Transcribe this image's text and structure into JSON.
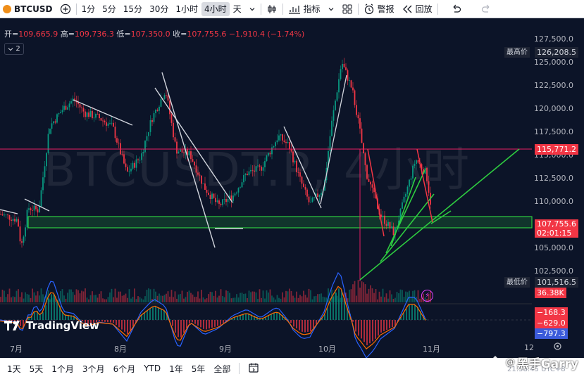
{
  "toolbar": {
    "symbol": "BTCUSD",
    "add_symbol": "+",
    "intervals": [
      "1分",
      "5分",
      "15分",
      "30分",
      "1小时",
      "4小时",
      "天"
    ],
    "selected_interval": "4小时",
    "indicators_label": "指标",
    "alert_label": "警报",
    "replay_label": "回放"
  },
  "ohlc": {
    "open_label": "开=",
    "open": "109,665.9",
    "high_label": "高=",
    "high": "109,736.3",
    "low_label": "低=",
    "low": "107,350.0",
    "close_label": "收=",
    "close": "107,755.6",
    "change": "−1,910.4 (−1.74%)"
  },
  "collapse_label": "2",
  "watermark": "BTCUSDT.P, 4小时",
  "price_axis": {
    "ticks": [
      "127,500.0",
      "125,000.0",
      "122,500.0",
      "120,000.0",
      "117,500.0",
      "115,000.0",
      "112,500.0",
      "110,000.0",
      "105,000.0",
      "102,500.0"
    ],
    "highest_label": "最高价",
    "highest": "126,208.5",
    "line_value": "115,771.2",
    "current": "107,755.6",
    "countdown": "02:01:15",
    "lowest_label": "最低价",
    "lowest": "101,516.5",
    "volume": "36.38K",
    "osc_values": [
      "−168.3",
      "−629.0",
      "−797.3"
    ]
  },
  "time_axis": [
    "7月",
    "8月",
    "9月",
    "10月",
    "11月",
    "12"
  ],
  "logo_text": "TradingView",
  "bottombar": {
    "ranges": [
      "1天",
      "5天",
      "1个月",
      "3个月",
      "6个月",
      "YTD",
      "1年",
      "5年",
      "全部"
    ]
  },
  "author": "黑手Garry",
  "clock": "21:58:45 UTC+8",
  "colors": {
    "background": "#0c1428",
    "up": "#089981",
    "down": "#f23645",
    "support_zone": "#2ecc40",
    "resistance_line": "#e91e63",
    "trend_lines": "#2ecc40",
    "drawn_lines": "#d1d4dc"
  },
  "icons": [
    "bar-style-icon",
    "indicators-icon",
    "layout-icon",
    "alert-icon",
    "replay-icon",
    "undo-icon",
    "redo-icon",
    "range-calendar-icon",
    "settings-icon"
  ]
}
